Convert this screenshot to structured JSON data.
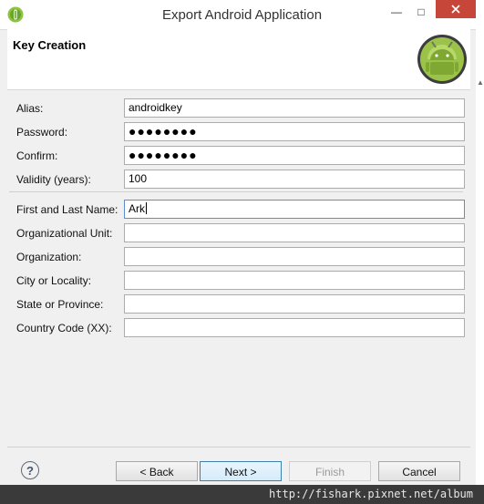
{
  "window": {
    "title": "Export Android Application",
    "minimize_glyph": "—",
    "maximize_glyph": "□",
    "close_glyph": "✕"
  },
  "banner": {
    "title": "Key Creation",
    "icon": "android-robot-icon"
  },
  "form": {
    "alias": {
      "label": "Alias:",
      "value": "androidkey"
    },
    "password": {
      "label": "Password:",
      "value": "●●●●●●●●"
    },
    "confirm": {
      "label": "Confirm:",
      "value": "●●●●●●●●"
    },
    "validity": {
      "label": "Validity (years):",
      "value": "100"
    },
    "name": {
      "label": "First and Last Name:",
      "value": "Ark"
    },
    "org_unit": {
      "label": "Organizational Unit:",
      "value": ""
    },
    "organization": {
      "label": "Organization:",
      "value": ""
    },
    "city": {
      "label": "City or Locality:",
      "value": ""
    },
    "state": {
      "label": "State or Province:",
      "value": ""
    },
    "country": {
      "label": "Country Code (XX):",
      "value": ""
    }
  },
  "footer": {
    "help_glyph": "?",
    "back": "< Back",
    "next": "Next >",
    "finish": "Finish",
    "cancel": "Cancel"
  },
  "watermark": "http://fishark.pixnet.net/album",
  "colors": {
    "close_button": "#c7463a",
    "focus_border": "#5b8fd0",
    "default_button_border": "#3c7fb1",
    "android_green": "#9bc34a"
  }
}
